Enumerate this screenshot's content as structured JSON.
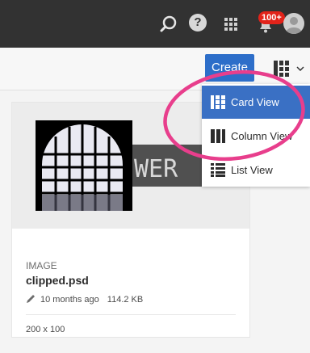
{
  "topbar": {
    "notification_count": "100+",
    "help_glyph": "?"
  },
  "actionbar": {
    "create_label": "Create"
  },
  "view_menu": {
    "items": [
      {
        "label": "Card View",
        "icon": "card-view-icon",
        "selected": true
      },
      {
        "label": "Column View",
        "icon": "column-view-icon",
        "selected": false
      },
      {
        "label": "List View",
        "icon": "list-view-icon",
        "selected": false
      }
    ]
  },
  "card": {
    "type": "IMAGE",
    "name": "clipped.psd",
    "modified": "10 months ago",
    "size": "114.2 KB",
    "dimensions": "200 x 100",
    "thumbnail_text": "WER"
  },
  "colors": {
    "topbar": "#323232",
    "primary": "#2d6ec9",
    "selected": "#3a70c4",
    "badge": "#e2231a",
    "annotation": "#e83e8c"
  }
}
